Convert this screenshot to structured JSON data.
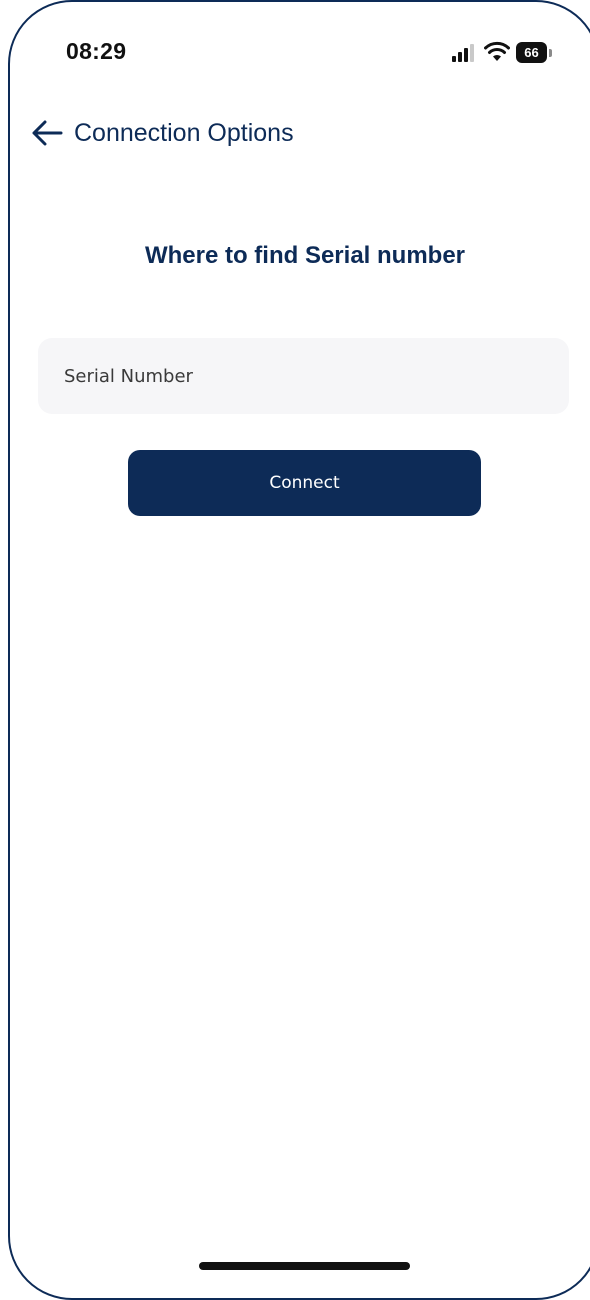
{
  "status_bar": {
    "time": "08:29",
    "battery_level": "66",
    "icons": [
      "signal-icon",
      "wifi-icon",
      "battery-icon"
    ]
  },
  "header": {
    "title": "Connection Options",
    "back_icon": "arrow-left-icon"
  },
  "main": {
    "section_title": "Where to find Serial number",
    "serial_input": {
      "placeholder": "Serial Number",
      "value": ""
    },
    "connect_label": "Connect"
  },
  "colors": {
    "brand_navy": "#0d2b57",
    "input_background": "#f6f6f8",
    "background": "#ffffff"
  }
}
